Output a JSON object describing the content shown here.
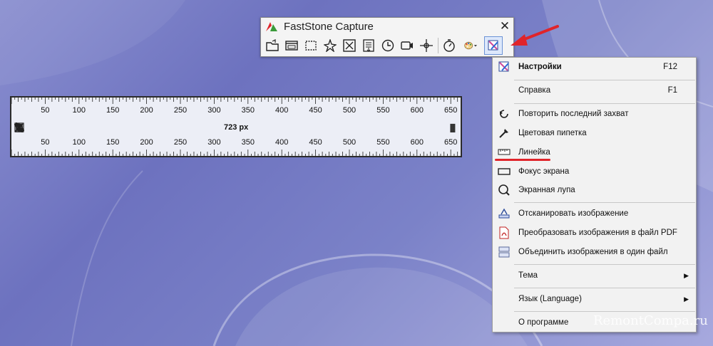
{
  "window": {
    "title": "FastStone Capture",
    "close_glyph": "✕",
    "tools": [
      {
        "name": "open-icon"
      },
      {
        "name": "capture-window-icon"
      },
      {
        "name": "capture-rectangle-icon"
      },
      {
        "name": "capture-freehand-icon"
      },
      {
        "name": "capture-fullscreen-icon"
      },
      {
        "name": "capture-scrolling-icon"
      },
      {
        "name": "delayed-capture-icon"
      },
      {
        "name": "screen-recorder-icon"
      },
      {
        "name": "crosshair-icon"
      },
      {
        "name": "timer-icon"
      },
      {
        "name": "palette-icon"
      },
      {
        "name": "settings-icon"
      }
    ]
  },
  "ruler": {
    "labels": [
      "50",
      "100",
      "150",
      "200",
      "250",
      "300",
      "350",
      "400",
      "450",
      "500",
      "550",
      "600",
      "650"
    ],
    "length_label": "723 px"
  },
  "menu": {
    "items": [
      {
        "label": "Настройки",
        "shortcut": "F12",
        "bold": true
      },
      {
        "label": "Справка",
        "shortcut": "F1"
      },
      {
        "label": "Повторить последний захват"
      },
      {
        "label": "Цветовая пипетка"
      },
      {
        "label": "Линейка"
      },
      {
        "label": "Фокус экрана"
      },
      {
        "label": "Экранная лупа"
      },
      {
        "label": "Отсканировать изображение"
      },
      {
        "label": "Преобразовать изображения в файл PDF"
      },
      {
        "label": "Объединить изображения в один файл"
      },
      {
        "label": "Тема",
        "submenu": "▶"
      },
      {
        "label": "Язык (Language)",
        "submenu": "▶"
      },
      {
        "label": "О программе"
      }
    ]
  },
  "watermark": "RemontCompa.ru",
  "colors": {
    "accent_red": "#e0242a",
    "menu_bg": "#f2f2f2",
    "ruler_bg": "#eceef6"
  }
}
